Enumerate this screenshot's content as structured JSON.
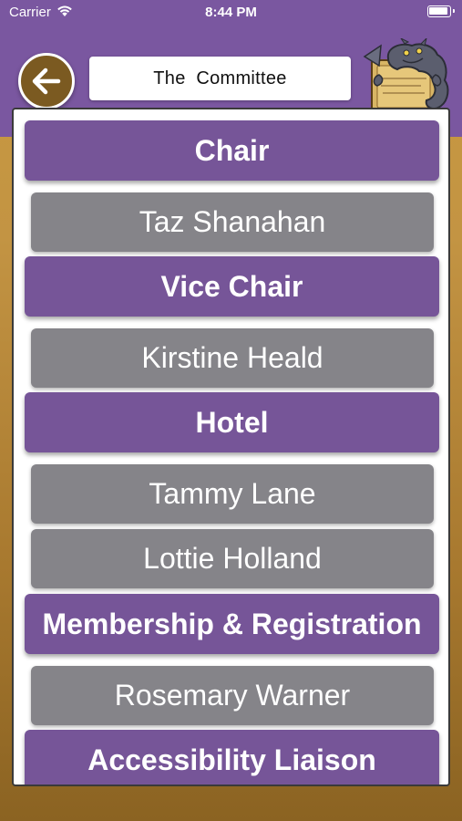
{
  "status_bar": {
    "carrier": "Carrier",
    "time": "8:44 PM"
  },
  "header": {
    "title": "The  Committee",
    "back_icon": "arrow-left-icon",
    "logo": "dragon-mascot-logo"
  },
  "colors": {
    "header_purple": "#7a57a0",
    "role_purple": "#765598",
    "person_gray": "#858489",
    "background_gold": "#c39443",
    "back_button_brown": "#7b5a21"
  },
  "committee": {
    "rows": [
      {
        "type": "role",
        "label": "Chair"
      },
      {
        "type": "person",
        "label": "Taz Shanahan"
      },
      {
        "type": "role",
        "label": "Vice Chair"
      },
      {
        "type": "person",
        "label": "Kirstine Heald"
      },
      {
        "type": "role",
        "label": "Hotel"
      },
      {
        "type": "person",
        "label": "Tammy Lane"
      },
      {
        "type": "person",
        "label": "Lottie Holland"
      },
      {
        "type": "role",
        "label": "Membership & Registration"
      },
      {
        "type": "person",
        "label": "Rosemary Warner"
      },
      {
        "type": "role",
        "label": "Accessibility Liaison"
      }
    ]
  }
}
